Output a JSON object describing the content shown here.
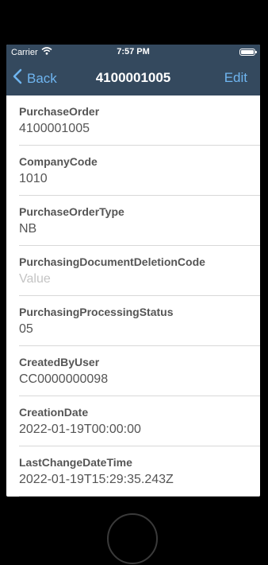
{
  "status_bar": {
    "carrier": "Carrier",
    "time": "7:57 PM",
    "wifi_icon": "wifi-icon",
    "battery_icon": "battery-icon"
  },
  "nav": {
    "back_label": "Back",
    "title": "4100001005",
    "edit_label": "Edit",
    "background_color": "#34495e",
    "accent_color": "#6fb5f0"
  },
  "fields": [
    {
      "label": "PurchaseOrder",
      "value": "4100001005"
    },
    {
      "label": "CompanyCode",
      "value": "1010"
    },
    {
      "label": "PurchaseOrderType",
      "value": "NB"
    },
    {
      "label": "PurchasingDocumentDeletionCode",
      "value": "Value"
    },
    {
      "label": "PurchasingProcessingStatus",
      "value": "05"
    },
    {
      "label": "CreatedByUser",
      "value": "CC0000000098"
    },
    {
      "label": "CreationDate",
      "value": "2022-01-19T00:00:00"
    },
    {
      "label": "LastChangeDateTime",
      "value": "2022-01-19T15:29:35.243Z"
    }
  ]
}
